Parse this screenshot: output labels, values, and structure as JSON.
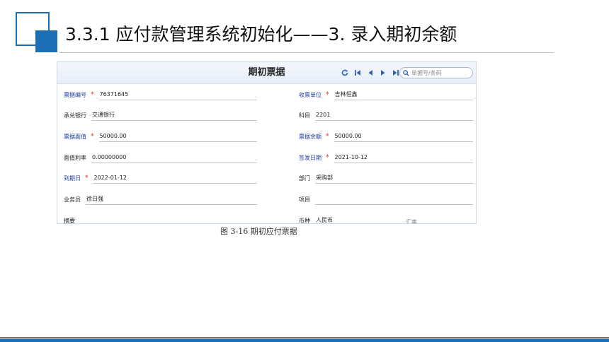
{
  "slide": {
    "title": "3.3.1  应付款管理系统初始化——3. 录入期初余额",
    "accent_color": "#1b6fb4"
  },
  "form": {
    "title": "期初票据",
    "nav_icons": [
      "refresh-icon",
      "first-record-icon",
      "previous-record-icon",
      "next-record-icon",
      "last-record-icon"
    ],
    "search": {
      "placeholder": "单据号/条码",
      "value": ""
    },
    "fields": {
      "bill_no": {
        "label": "票据编号",
        "required": true,
        "value": "76371645"
      },
      "receiver": {
        "label": "收票单位",
        "required": true,
        "value": "吉林恒鑫"
      },
      "bank": {
        "label": "承兑银行",
        "required": false,
        "value": "交通银行"
      },
      "subject": {
        "label": "科目",
        "required": false,
        "value": "2201"
      },
      "face_value": {
        "label": "票据面值",
        "required": true,
        "value": "50000.00"
      },
      "balance": {
        "label": "票据余额",
        "required": true,
        "value": "50000.00"
      },
      "face_rate": {
        "label": "面值利率",
        "required": false,
        "value": "0.00000000"
      },
      "issue_date": {
        "label": "签发日期",
        "required": true,
        "value": "2021-10-12"
      },
      "due_date": {
        "label": "到期日",
        "required": true,
        "value": "2022-01-12"
      },
      "department": {
        "label": "部门",
        "required": false,
        "value": "采购部"
      },
      "salesperson": {
        "label": "业务员",
        "required": false,
        "value": "徐日强"
      },
      "project": {
        "label": "项目",
        "required": false,
        "value": ""
      },
      "summary": {
        "label": "摘要",
        "required": false,
        "value": ""
      },
      "currency": {
        "label": "币种",
        "required": false,
        "value": "人民币"
      },
      "exchange_rate": {
        "label": "汇率",
        "required": false,
        "value": ""
      }
    }
  },
  "caption": "图 3-16  期初应付票据"
}
